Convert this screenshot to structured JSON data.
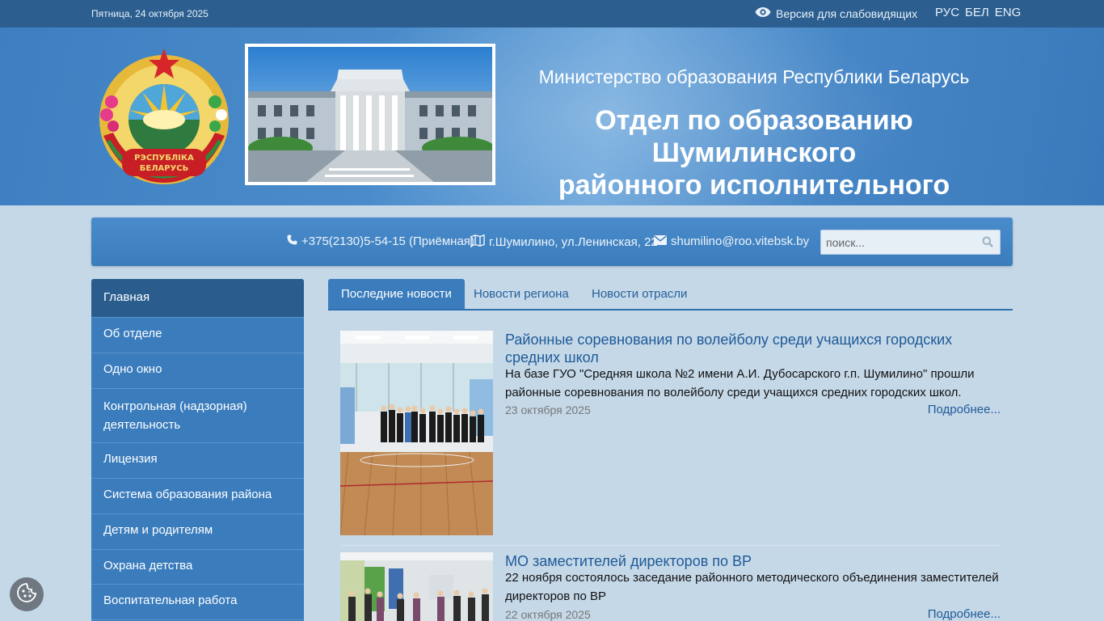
{
  "topbar": {
    "date": "Пятница, 24 октября 2025",
    "vision_label": "Версия для слабовидящих",
    "vision_icon": "eye-icon",
    "languages": [
      "РУС",
      "БЕЛ",
      "ENG"
    ]
  },
  "header": {
    "emblem_text": [
      "РЭСПУБЛІКА",
      "БЕЛАРУСЬ"
    ],
    "ministry": "Министерство образования Республики Беларусь",
    "department_line1": "Отдел по образованию Шумилинского",
    "department_line2": "районного исполнительного комитета"
  },
  "contacts": {
    "phone": "+375(2130)5-54-15 (Приёмная)",
    "address": "г.Шумилино, ул.Ленинская, 22",
    "email": "shumilino@roo.vitebsk.by",
    "search_placeholder": "поиск..."
  },
  "sidebar": {
    "items": [
      {
        "label": "Главная"
      },
      {
        "label": "Об отделе"
      },
      {
        "label": "Одно окно"
      },
      {
        "label": "Контрольная (надзорная) деятельность"
      },
      {
        "label": "Лицензия"
      },
      {
        "label": "Система образования района"
      },
      {
        "label": "Детям и родителям"
      },
      {
        "label": "Охрана детства"
      },
      {
        "label": "Воспитательная работа"
      }
    ]
  },
  "tabs": [
    {
      "label": "Последние новости"
    },
    {
      "label": "Новости региона"
    },
    {
      "label": "Новости отрасли"
    }
  ],
  "news": [
    {
      "title": "Районные соревнования по волейболу среди учащихся городских средних школ",
      "text": "На базе ГУО \"Средняя школа №2 имени А.И. Дубосарского г.п. Шумилино\" прошли районные соревнования по волейболу среди учащихся средних городских школ.",
      "date": "23 октября 2025",
      "more": "Подробнее..."
    },
    {
      "title": "МО заместителей директоров по ВР",
      "text": "22 ноября состоялось заседание районного методического объединения заместителей директоров по ВР",
      "date": "22 октября 2025",
      "more": "Подробнее..."
    }
  ],
  "colors": {
    "topbar": "#2c5f90",
    "accent": "#3a7cbc",
    "active_menu": "#2a5d8e",
    "link": "#1f5a96",
    "page_bg": "#c5d8e8"
  }
}
